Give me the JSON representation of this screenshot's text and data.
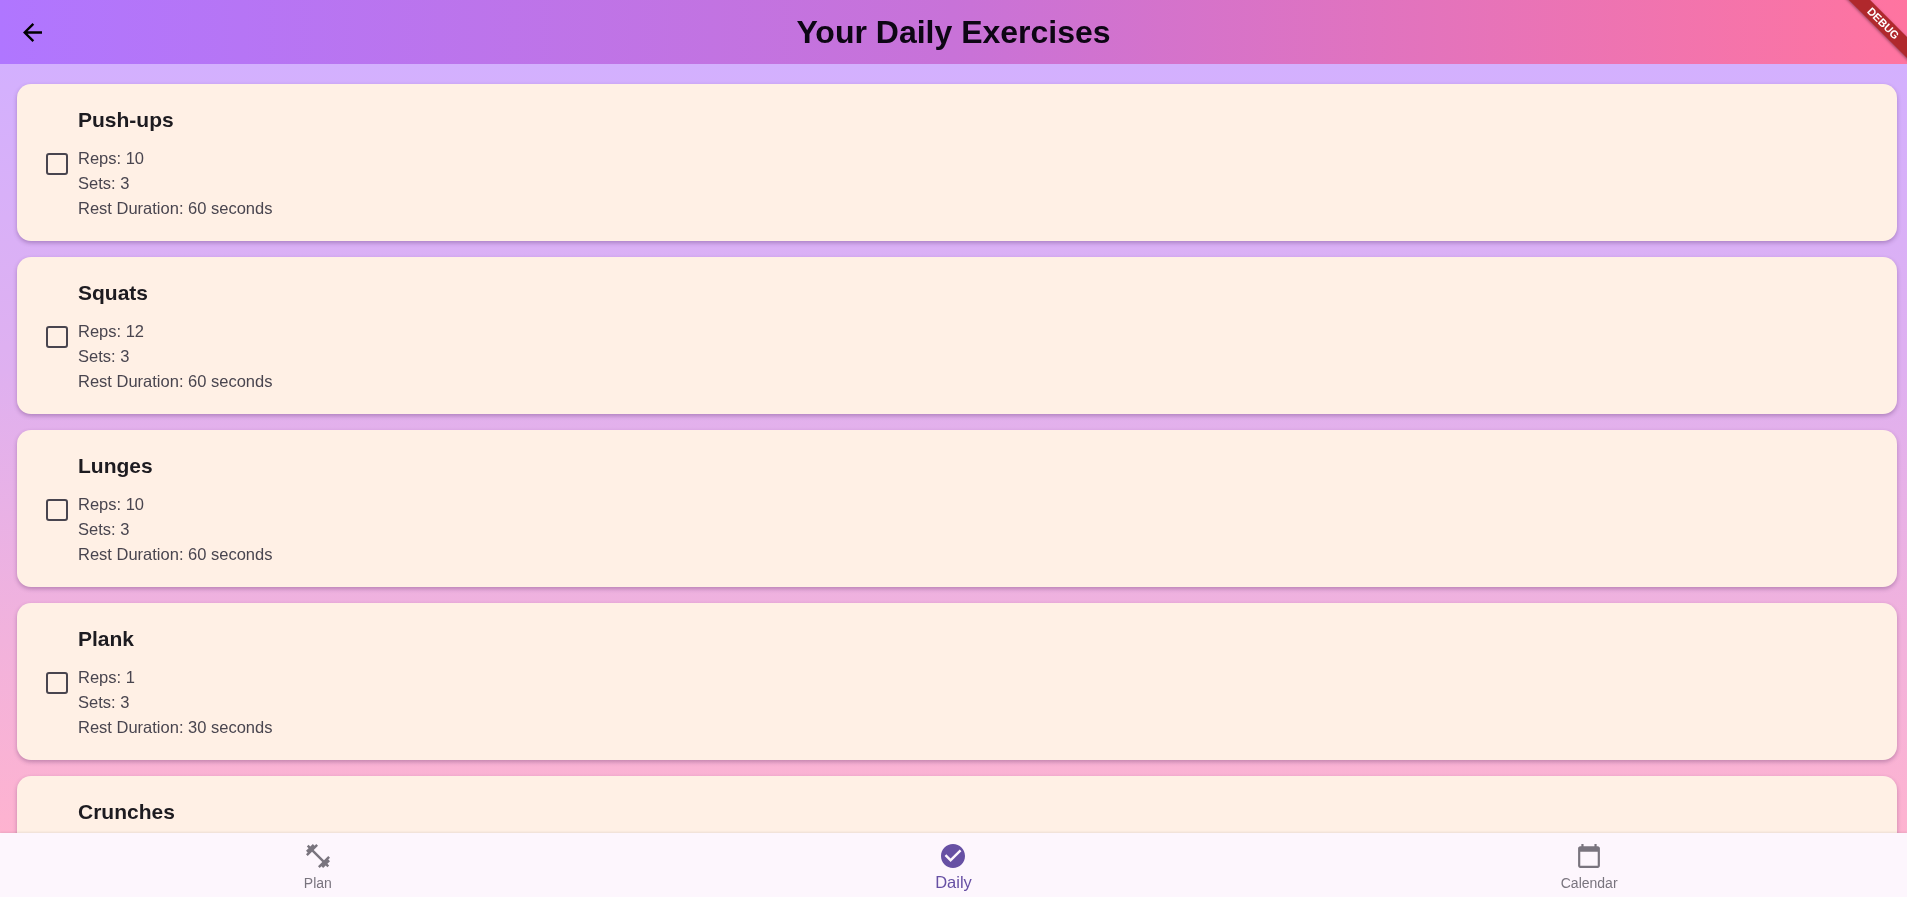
{
  "app_bar": {
    "title": "Your Daily Exercises",
    "debug_banner": "DEBUG"
  },
  "exercises": [
    {
      "name": "Push-ups",
      "checked": false,
      "details": [
        "Reps: 10",
        "Sets: 3",
        "Rest Duration: 60 seconds"
      ]
    },
    {
      "name": "Squats",
      "checked": false,
      "details": [
        "Reps: 12",
        "Sets: 3",
        "Rest Duration: 60 seconds"
      ]
    },
    {
      "name": "Lunges",
      "checked": false,
      "details": [
        "Reps: 10",
        "Sets: 3",
        "Rest Duration: 60 seconds"
      ]
    },
    {
      "name": "Plank",
      "checked": false,
      "details": [
        "Reps: 1",
        "Sets: 3",
        "Rest Duration: 30 seconds"
      ]
    },
    {
      "name": "Crunches"
    }
  ],
  "bottom_nav": {
    "items": [
      {
        "label": "Plan",
        "selected": false
      },
      {
        "label": "Daily",
        "selected": true
      },
      {
        "label": "Calendar",
        "selected": false
      }
    ]
  }
}
